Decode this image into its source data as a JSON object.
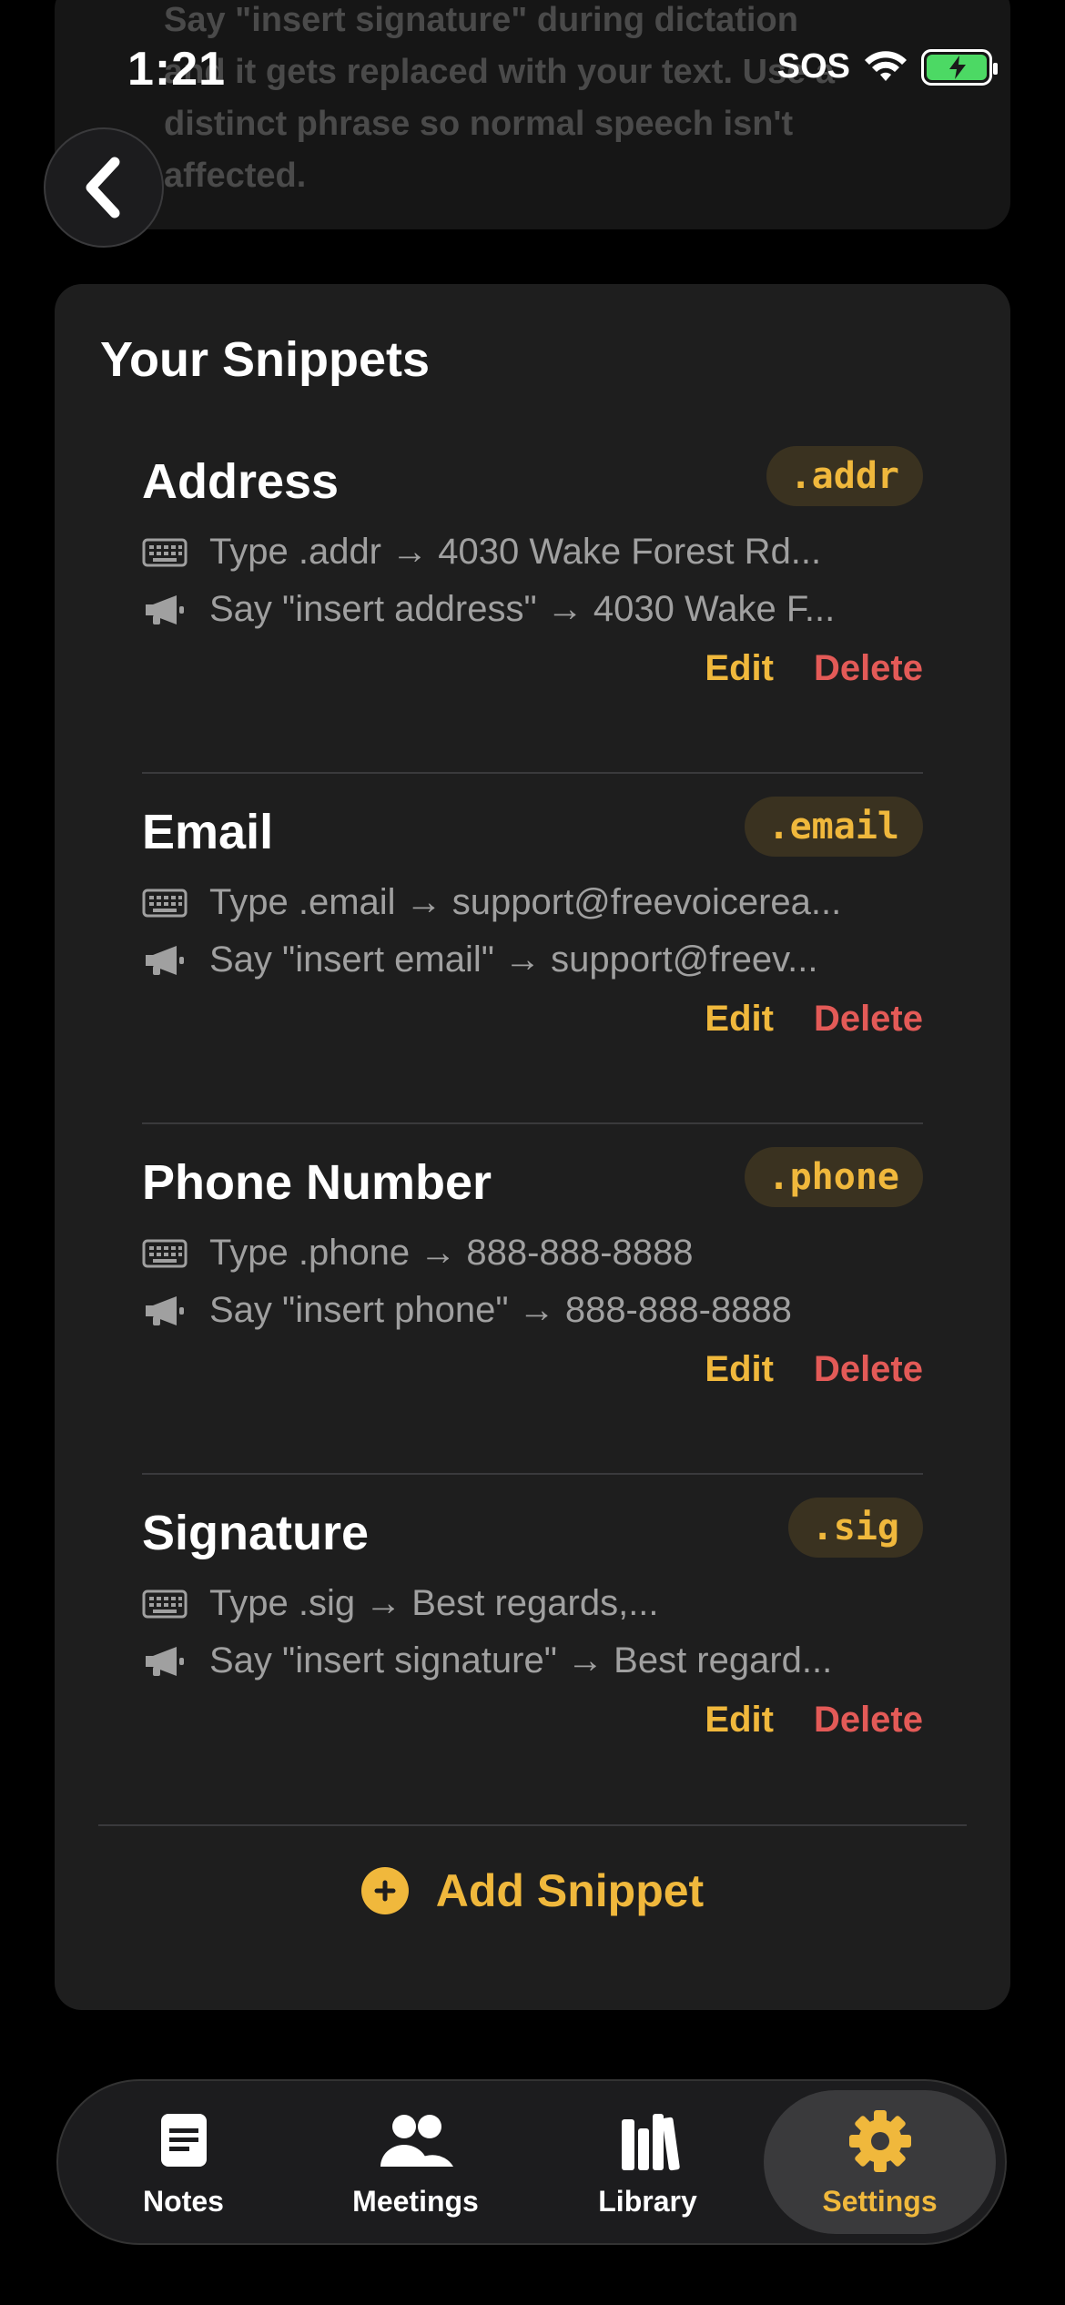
{
  "status": {
    "time": "1:21",
    "carrier": "SOS"
  },
  "info_card": {
    "text": "Say \"insert signature\" during dictation and it gets replaced with your text. Use a distinct phrase so normal speech isn't affected."
  },
  "snippets_title": "Your Snippets",
  "snippets": [
    {
      "name": "Address",
      "tag": ".addr",
      "type_line": "Type .addr → 4030 Wake Forest Rd...",
      "say_line": "Say \"insert address\" → 4030 Wake F...",
      "edit_label": "Edit",
      "delete_label": "Delete"
    },
    {
      "name": "Email",
      "tag": ".email",
      "type_line": "Type .email → support@freevoicerea...",
      "say_line": "Say \"insert email\" → support@freev...",
      "edit_label": "Edit",
      "delete_label": "Delete"
    },
    {
      "name": "Phone Number",
      "tag": ".phone",
      "type_line": "Type .phone → 888-888-8888",
      "say_line": "Say \"insert phone\" → 888-888-8888",
      "edit_label": "Edit",
      "delete_label": "Delete"
    },
    {
      "name": "Signature",
      "tag": ".sig",
      "type_line": "Type .sig → Best regards,...",
      "say_line": "Say \"insert signature\" → Best regard...",
      "edit_label": "Edit",
      "delete_label": "Delete"
    }
  ],
  "add_snippet_label": "Add Snippet",
  "tabs": [
    {
      "label": "Notes",
      "icon": "notes-icon"
    },
    {
      "label": "Meetings",
      "icon": "people-icon"
    },
    {
      "label": "Library",
      "icon": "books-icon"
    },
    {
      "label": "Settings",
      "icon": "gear-icon",
      "active": true
    }
  ],
  "colors": {
    "accent": "#f0b83c",
    "danger": "#e35a57",
    "background": "#000000",
    "card": "#1e1e1e"
  }
}
